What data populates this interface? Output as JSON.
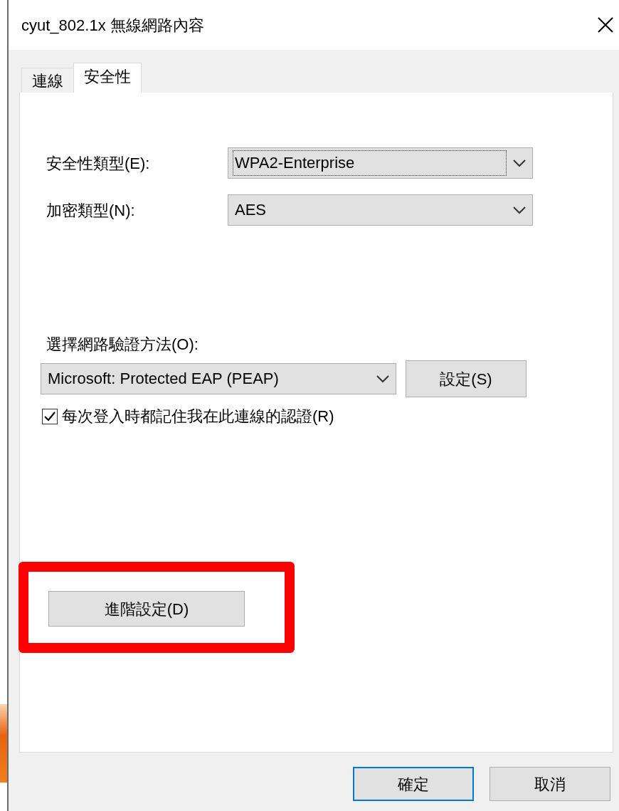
{
  "window": {
    "title": "cyut_802.1x 無線網路內容"
  },
  "tabs": [
    {
      "label": "連線",
      "selected": false
    },
    {
      "label": "安全性",
      "selected": true
    }
  ],
  "security_fields": [
    {
      "label": "安全性類型(E):",
      "value": "WPA2-Enterprise",
      "focused": true
    },
    {
      "label": "加密類型(N):",
      "value": "AES",
      "focused": false
    }
  ],
  "auth_method": {
    "label": "選擇網路驗證方法(O):",
    "value": "Microsoft: Protected EAP (PEAP)",
    "settings_button": "設定(S)"
  },
  "remember_credentials": {
    "label": "每次登入時都記住我在此連線的認證(R)",
    "checked": true
  },
  "advanced_button": {
    "label": "進階設定(D)",
    "highlighted": true
  },
  "buttons": [
    {
      "label": "確定",
      "default": true
    },
    {
      "label": "取消",
      "default": false
    }
  ]
}
